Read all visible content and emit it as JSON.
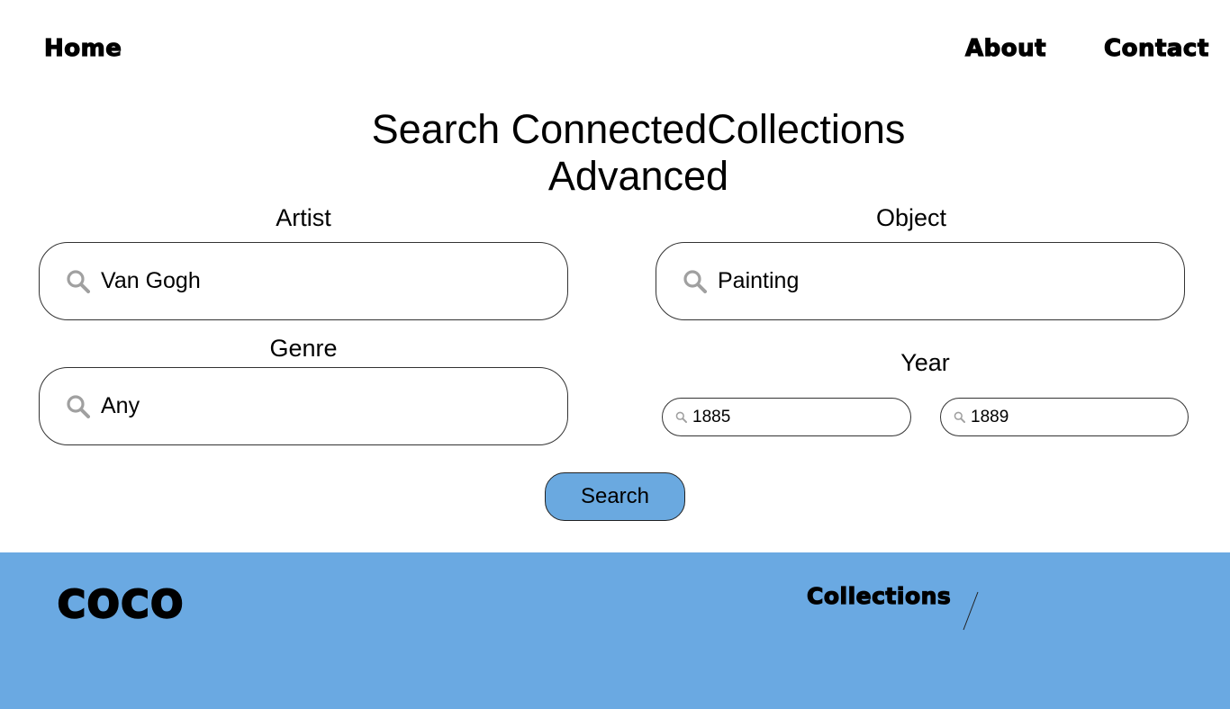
{
  "nav": {
    "home": "Home",
    "about": "About",
    "contact": "Contact"
  },
  "title": {
    "line1": "Search ConnectedCollections",
    "line2": "Advanced"
  },
  "fields": {
    "artist": {
      "label": "Artist",
      "value": "Van Gogh"
    },
    "object": {
      "label": "Object",
      "value": "Painting"
    },
    "genre": {
      "label": "Genre",
      "value": "Any"
    },
    "year": {
      "label": "Year",
      "from": "1885",
      "to": "1889"
    }
  },
  "search_button": "Search",
  "footer": {
    "logo": "COCO",
    "link": "Collections"
  },
  "icons": {
    "search": "magnifier-icon"
  },
  "colors": {
    "accent": "#6aa9e2",
    "icon_gray": "#a0a0a0"
  }
}
